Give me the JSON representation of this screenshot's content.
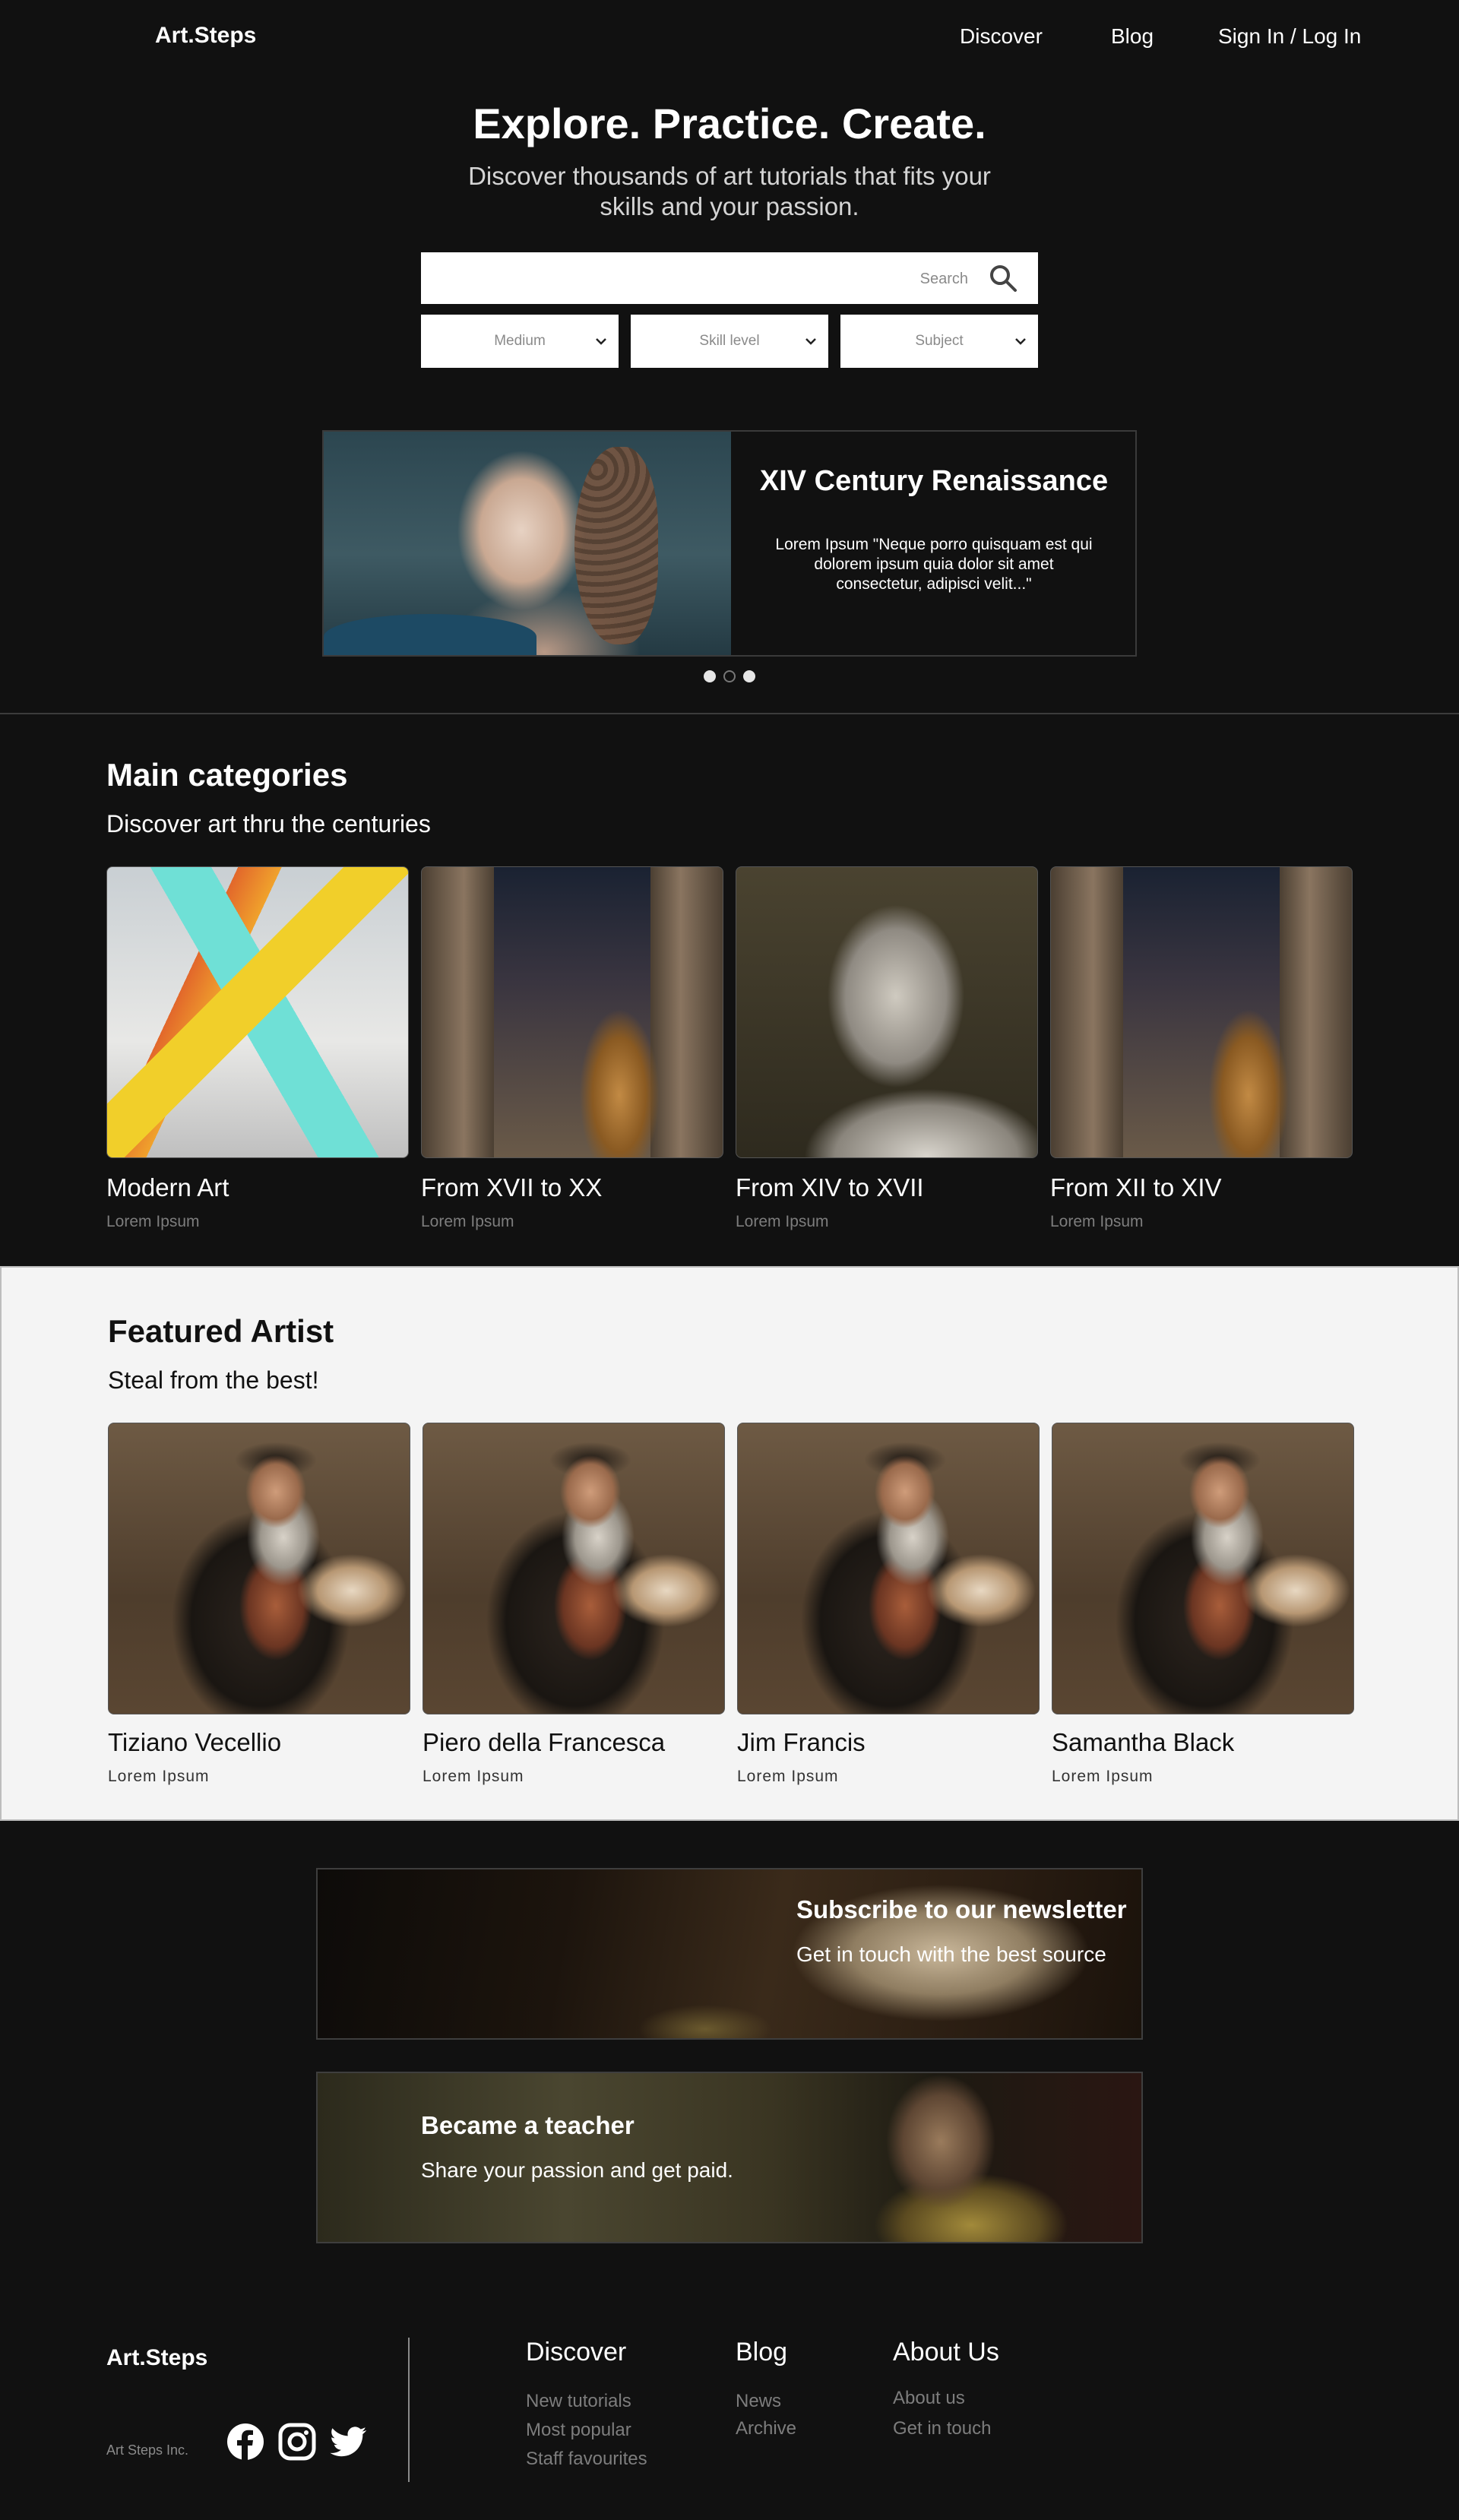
{
  "nav": {
    "logo": "Art.Steps",
    "links": [
      "Discover",
      "Blog",
      "Sign In / Log In"
    ]
  },
  "hero": {
    "title": "Explore. Practice. Create.",
    "subtitle": "Discover thousands of art tutorials that fits your skills and your passion.",
    "search_placeholder": "Search",
    "filters": [
      "Medium",
      "Skill level",
      "Subject"
    ]
  },
  "carousel": {
    "title": "XIV Century Renaissance",
    "text": "Lorem Ipsum \"Neque porro quisquam est qui dolorem ipsum quia dolor sit amet consectetur, adipisci velit...\"",
    "slides": 3,
    "active_slide": 1
  },
  "categories": {
    "title": "Main categories",
    "subtitle": "Discover art thru the centuries",
    "items": [
      {
        "name": "Modern Art",
        "sub": "Lorem Ipsum"
      },
      {
        "name": "From XVII to XX",
        "sub": "Lorem Ipsum"
      },
      {
        "name": "From XIV to XVII",
        "sub": "Lorem Ipsum"
      },
      {
        "name": "From XII to XIV",
        "sub": "Lorem Ipsum"
      }
    ]
  },
  "featured": {
    "title": "Featured Artist",
    "subtitle": "Steal from the best!",
    "items": [
      {
        "name": "Tiziano Vecellio",
        "sub": "Lorem Ipsum"
      },
      {
        "name": "Piero della Francesca",
        "sub": "Lorem Ipsum"
      },
      {
        "name": "Jim Francis",
        "sub": "Lorem Ipsum"
      },
      {
        "name": "Samantha Black",
        "sub": "Lorem Ipsum"
      }
    ]
  },
  "newsletter": {
    "title": "Subscribe to our newsletter",
    "text": "Get in touch with the best source"
  },
  "teacher": {
    "title": "Became a teacher",
    "text": "Share your passion and get paid."
  },
  "footer": {
    "logo": "Art.Steps",
    "company": "Art Steps Inc.",
    "social_icons": [
      "facebook-icon",
      "instagram-icon",
      "twitter-icon"
    ],
    "columns": [
      {
        "title": "Discover",
        "links": [
          "New tutorials",
          "Most popular",
          "Staff favourites"
        ]
      },
      {
        "title": "Blog",
        "links": [
          "News",
          "Archive"
        ]
      },
      {
        "title": "About Us",
        "links": [
          "About us",
          "Get in touch"
        ]
      }
    ]
  },
  "colors": {
    "background": "#111111",
    "featured_background": "#f4f4f4",
    "text": "#ffffff",
    "muted": "#7d7d7d"
  }
}
